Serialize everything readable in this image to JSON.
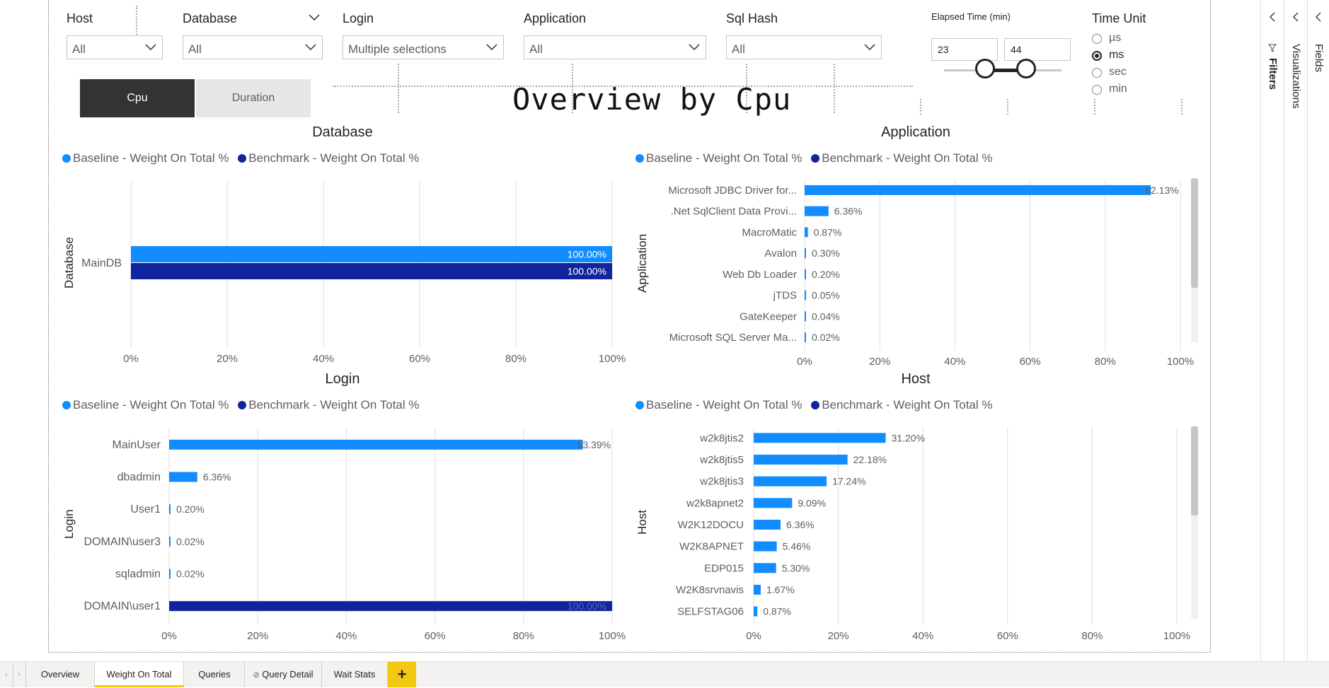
{
  "slicers": {
    "host": {
      "title": "Host",
      "value": "All"
    },
    "database": {
      "title": "Database",
      "value": "All"
    },
    "login": {
      "title": "Login",
      "value": "Multiple selections"
    },
    "application": {
      "title": "Application",
      "value": "All"
    },
    "sqlhash": {
      "title": "Sql Hash",
      "value": "All"
    }
  },
  "elapsed": {
    "title": "Elapsed Time (min)",
    "from": "23",
    "to": "44"
  },
  "time_unit": {
    "title": "Time Unit",
    "options": [
      "µs",
      "ms",
      "sec",
      "min"
    ],
    "selected": "ms"
  },
  "toggle": {
    "cpu": "Cpu",
    "duration": "Duration"
  },
  "page_title": "Overview by Cpu",
  "colors": {
    "baseline": "#118dff",
    "benchmark": "#12239e",
    "active_tab": "#f2c811",
    "toggle_active": "#333333"
  },
  "legend": {
    "baseline": "Baseline - Weight On Total %",
    "benchmark": "Benchmark - Weight On Total %"
  },
  "panes": {
    "filters": "Filters",
    "visualizations": "Visualizations",
    "fields": "Fields"
  },
  "tabs": [
    "Overview",
    "Weight On Total",
    "Queries",
    "Query Detail",
    "Wait Stats"
  ],
  "active_tab": "Weight On Total",
  "chart_data": [
    {
      "type": "bar",
      "title": "Database",
      "ylabel": "Database",
      "xlim": [
        0,
        100
      ],
      "xticks": [
        "0%",
        "20%",
        "40%",
        "60%",
        "80%",
        "100%"
      ],
      "categories": [
        "MainDB"
      ],
      "series": [
        {
          "name": "Baseline - Weight On Total %",
          "values": [
            100.0
          ],
          "labels": [
            "100.00%"
          ]
        },
        {
          "name": "Benchmark - Weight On Total %",
          "values": [
            100.0
          ],
          "labels": [
            "100.00%"
          ]
        }
      ]
    },
    {
      "type": "bar",
      "title": "Application",
      "ylabel": "Application",
      "xlim": [
        0,
        100
      ],
      "xticks": [
        "0%",
        "20%",
        "40%",
        "60%",
        "80%",
        "100%"
      ],
      "categories": [
        "Microsoft JDBC Driver for...",
        ".Net SqlClient Data Provi...",
        "MacroMatic",
        "Avalon",
        "Web Db Loader",
        "jTDS",
        "GateKeeper",
        "Microsoft SQL Server Ma..."
      ],
      "series": [
        {
          "name": "Baseline - Weight On Total %",
          "values": [
            92.13,
            6.36,
            0.87,
            0.3,
            0.2,
            0.05,
            0.04,
            0.02
          ],
          "labels": [
            "92.13%",
            "6.36%",
            "0.87%",
            "0.30%",
            "0.20%",
            "0.05%",
            "0.04%",
            "0.02%"
          ]
        }
      ]
    },
    {
      "type": "bar",
      "title": "Login",
      "ylabel": "Login",
      "xlim": [
        0,
        100
      ],
      "xticks": [
        "0%",
        "20%",
        "40%",
        "60%",
        "80%",
        "100%"
      ],
      "categories": [
        "MainUser",
        "dbadmin",
        "User1",
        "DOMAIN\\user3",
        "sqladmin",
        "DOMAIN\\user1"
      ],
      "series": [
        {
          "name": "Baseline - Weight On Total %",
          "values": [
            93.39,
            6.36,
            0.2,
            0.02,
            0.02,
            null
          ],
          "labels": [
            "93.39%",
            "6.36%",
            "0.20%",
            "0.02%",
            "0.02%",
            ""
          ]
        },
        {
          "name": "Benchmark - Weight On Total %",
          "values": [
            null,
            null,
            null,
            null,
            null,
            100.0
          ],
          "labels": [
            "",
            "",
            "",
            "",
            "",
            "100.00%"
          ]
        }
      ]
    },
    {
      "type": "bar",
      "title": "Host",
      "ylabel": "Host",
      "xlim": [
        0,
        100
      ],
      "xticks": [
        "0%",
        "20%",
        "40%",
        "60%",
        "80%",
        "100%"
      ],
      "categories": [
        "w2k8jtis2",
        "w2k8jtis5",
        "w2k8jtis3",
        "w2k8apnet2",
        "W2K12DOCU",
        "W2K8APNET",
        "EDP015",
        "W2K8srvnavis",
        "SELFSTAG06"
      ],
      "series": [
        {
          "name": "Baseline - Weight On Total %",
          "values": [
            31.2,
            22.18,
            17.24,
            9.09,
            6.36,
            5.46,
            5.3,
            1.67,
            0.87
          ],
          "labels": [
            "31.20%",
            "22.18%",
            "17.24%",
            "9.09%",
            "6.36%",
            "5.46%",
            "5.30%",
            "1.67%",
            "0.87%"
          ]
        }
      ]
    }
  ]
}
